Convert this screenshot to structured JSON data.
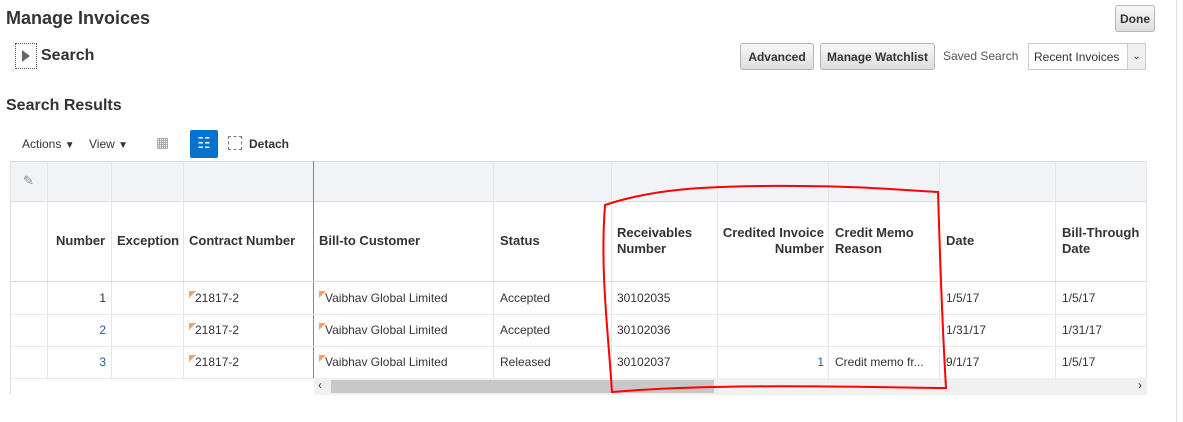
{
  "header": {
    "title": "Manage Invoices",
    "done": "Done"
  },
  "search": {
    "label": "Search",
    "advanced": "Advanced",
    "manage_watchlist": "Manage Watchlist",
    "saved_search_label": "Saved Search",
    "saved_search_value": "Recent Invoices"
  },
  "results": {
    "title": "Search Results",
    "actions": "Actions",
    "view": "View",
    "detach": "Detach"
  },
  "table": {
    "columns": [
      "Number",
      "Exception",
      "Contract Number",
      "Bill-to Customer",
      "Status",
      "Receivables Number",
      "Credited Invoice Number",
      "Credit Memo Reason",
      "Date",
      "Bill-Through Date"
    ],
    "rows": [
      {
        "number": "1",
        "exception": "",
        "contract": "21817-2",
        "customer": "Vaibhav Global Limited",
        "status": "Accepted",
        "receivables": "30102035",
        "credited": "",
        "reason": "",
        "date": "1/5/17",
        "bill_through": "1/5/17"
      },
      {
        "number": "2",
        "exception": "",
        "contract": "21817-2",
        "customer": "Vaibhav Global Limited",
        "status": "Accepted",
        "receivables": "30102036",
        "credited": "",
        "reason": "",
        "date": "1/31/17",
        "bill_through": "1/31/17"
      },
      {
        "number": "3",
        "exception": "",
        "contract": "21817-2",
        "customer": "Vaibhav Global Limited",
        "status": "Released",
        "receivables": "30102037",
        "credited": "1",
        "reason": "Credit memo fr...",
        "date": "9/1/17",
        "bill_through": "1/5/17"
      }
    ]
  },
  "colors": {
    "accent": "#0572ce",
    "annotation": "#ff0000"
  }
}
